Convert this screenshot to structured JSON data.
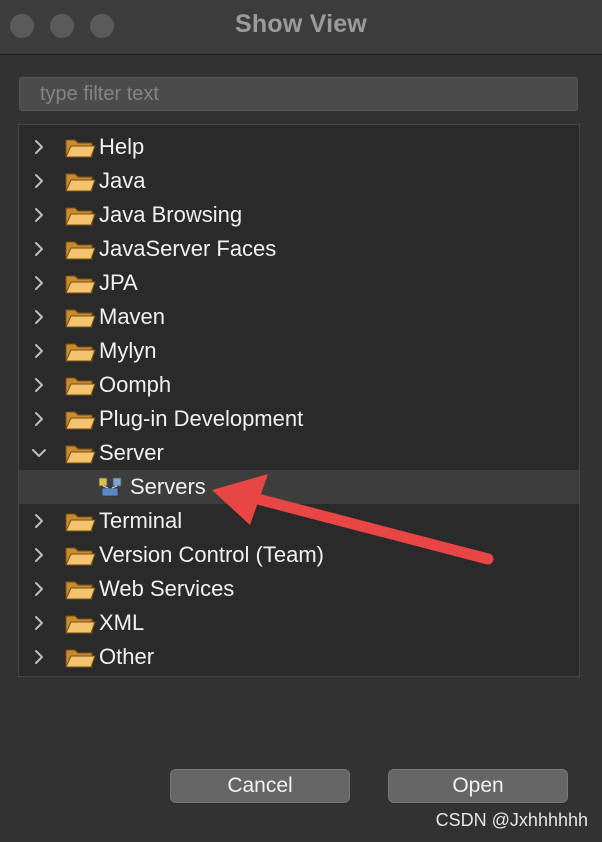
{
  "window": {
    "title": "Show View"
  },
  "filter": {
    "placeholder": "type filter text"
  },
  "tree": {
    "items": [
      {
        "label": "Help",
        "expanded": false
      },
      {
        "label": "Java",
        "expanded": false
      },
      {
        "label": "Java Browsing",
        "expanded": false
      },
      {
        "label": "JavaServer Faces",
        "expanded": false
      },
      {
        "label": "JPA",
        "expanded": false
      },
      {
        "label": "Maven",
        "expanded": false
      },
      {
        "label": "Mylyn",
        "expanded": false
      },
      {
        "label": "Oomph",
        "expanded": false
      },
      {
        "label": "Plug-in Development",
        "expanded": false
      },
      {
        "label": "Server",
        "expanded": true,
        "children": [
          {
            "label": "Servers",
            "selected": true
          }
        ]
      },
      {
        "label": "Terminal",
        "expanded": false
      },
      {
        "label": "Version Control (Team)",
        "expanded": false
      },
      {
        "label": "Web Services",
        "expanded": false
      },
      {
        "label": "XML",
        "expanded": false
      },
      {
        "label": "Other",
        "expanded": false
      }
    ]
  },
  "buttons": {
    "cancel_label": "Cancel",
    "open_label": "Open"
  },
  "watermark": "CSDN @Jxhhhhhh",
  "colors": {
    "arrow": "#e84545",
    "folder": "#e9b25a",
    "background": "#323232"
  },
  "icons": {
    "collapsed": "chevron-right-icon",
    "expanded": "chevron-down-icon",
    "folder": "folder-icon",
    "view": "servers-icon"
  }
}
